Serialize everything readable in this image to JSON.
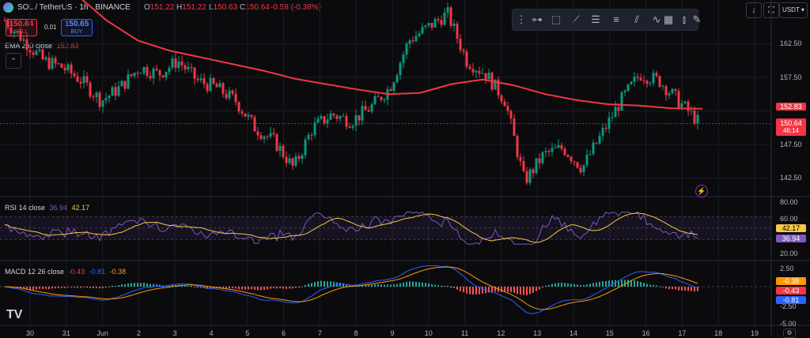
{
  "header": {
    "symbol": "SOL / TetherUS · 1h · BINANCE",
    "open_label": "O",
    "open": "151.22",
    "high_label": "H",
    "high": "151.22",
    "low_label": "L",
    "low": "150.63",
    "close_label": "C",
    "close": "150.64",
    "change": "-0.58 (-0.38%)"
  },
  "trade": {
    "sell_price": "150.64",
    "sell_label": "SELL",
    "spread": "0.01",
    "buy_price": "150.65",
    "buy_label": "BUY"
  },
  "ema": {
    "label": "EMA 200 close",
    "value": "152.83"
  },
  "rsi": {
    "label": "RSI 14 close",
    "value1": "36.94",
    "value2": "42.17"
  },
  "macd": {
    "label": "MACD 12 26 close",
    "v1": "-0.43",
    "v2": "-0.81",
    "v3": "-0.38"
  },
  "price_axis": {
    "ticks": [
      "162.50",
      "157.50",
      "152.50",
      "147.50",
      "142.50"
    ],
    "ema_tag": "152.83",
    "price_tag": "150.64",
    "countdown": "46:14"
  },
  "rsi_axis": {
    "ticks": [
      "80.00",
      "60.00",
      "20.00"
    ],
    "tag1": "42.17",
    "tag2": "36.94"
  },
  "macd_axis": {
    "ticks": [
      "2.50",
      "-2.50",
      "-5.00"
    ],
    "tag1": "-0.38",
    "tag2": "-0.43",
    "tag3": "-0.81"
  },
  "time_axis": [
    "30",
    "31",
    "Jun",
    "2",
    "3",
    "4",
    "5",
    "6",
    "7",
    "8",
    "9",
    "10",
    "11",
    "12",
    "13",
    "14",
    "15",
    "16",
    "17",
    "18",
    "19"
  ],
  "currency": "USDT",
  "colors": {
    "up": "#089981",
    "down": "#f23645",
    "ema": "#f23645",
    "rsi": "#7e57c2",
    "rsi_ma": "#f7c948",
    "macd": "#2962ff",
    "signal": "#ff9800",
    "bg": "#0b0b0e"
  },
  "chart_data": {
    "type": "candlestick",
    "x": [
      "30",
      "31",
      "Jun",
      "2",
      "3",
      "4",
      "5",
      "6",
      "7",
      "8",
      "9",
      "10",
      "11",
      "12",
      "13",
      "14",
      "15",
      "16",
      "17",
      "18",
      "19"
    ],
    "price_ticks": [
      162.5,
      157.5,
      152.5,
      147.5,
      142.5
    ],
    "close_path_keypoints": [
      166,
      163,
      160,
      159,
      157,
      154,
      156,
      159,
      158,
      160,
      157,
      156,
      154,
      150,
      148,
      144,
      150,
      152,
      151,
      153,
      156,
      163,
      165,
      167,
      160,
      158,
      154,
      142,
      146,
      147,
      144,
      149,
      154,
      158,
      157,
      154,
      151
    ],
    "ema200_keypoints": [
      170,
      166,
      163,
      161.5,
      160.5,
      159.5,
      158.5,
      157.3,
      156.5,
      155.7,
      155,
      155.2,
      156.5,
      157.2,
      156.3,
      155,
      154.1,
      153.5,
      153.3,
      152.9,
      152.83
    ],
    "last_price": 150.64,
    "ema200_last": 152.83,
    "rsi_levels": [
      80,
      60,
      20
    ],
    "rsi_last": 36.94,
    "rsi_ma_last": 42.17,
    "macd_last": -0.43,
    "signal_last": -0.81,
    "hist_last": -0.38
  }
}
